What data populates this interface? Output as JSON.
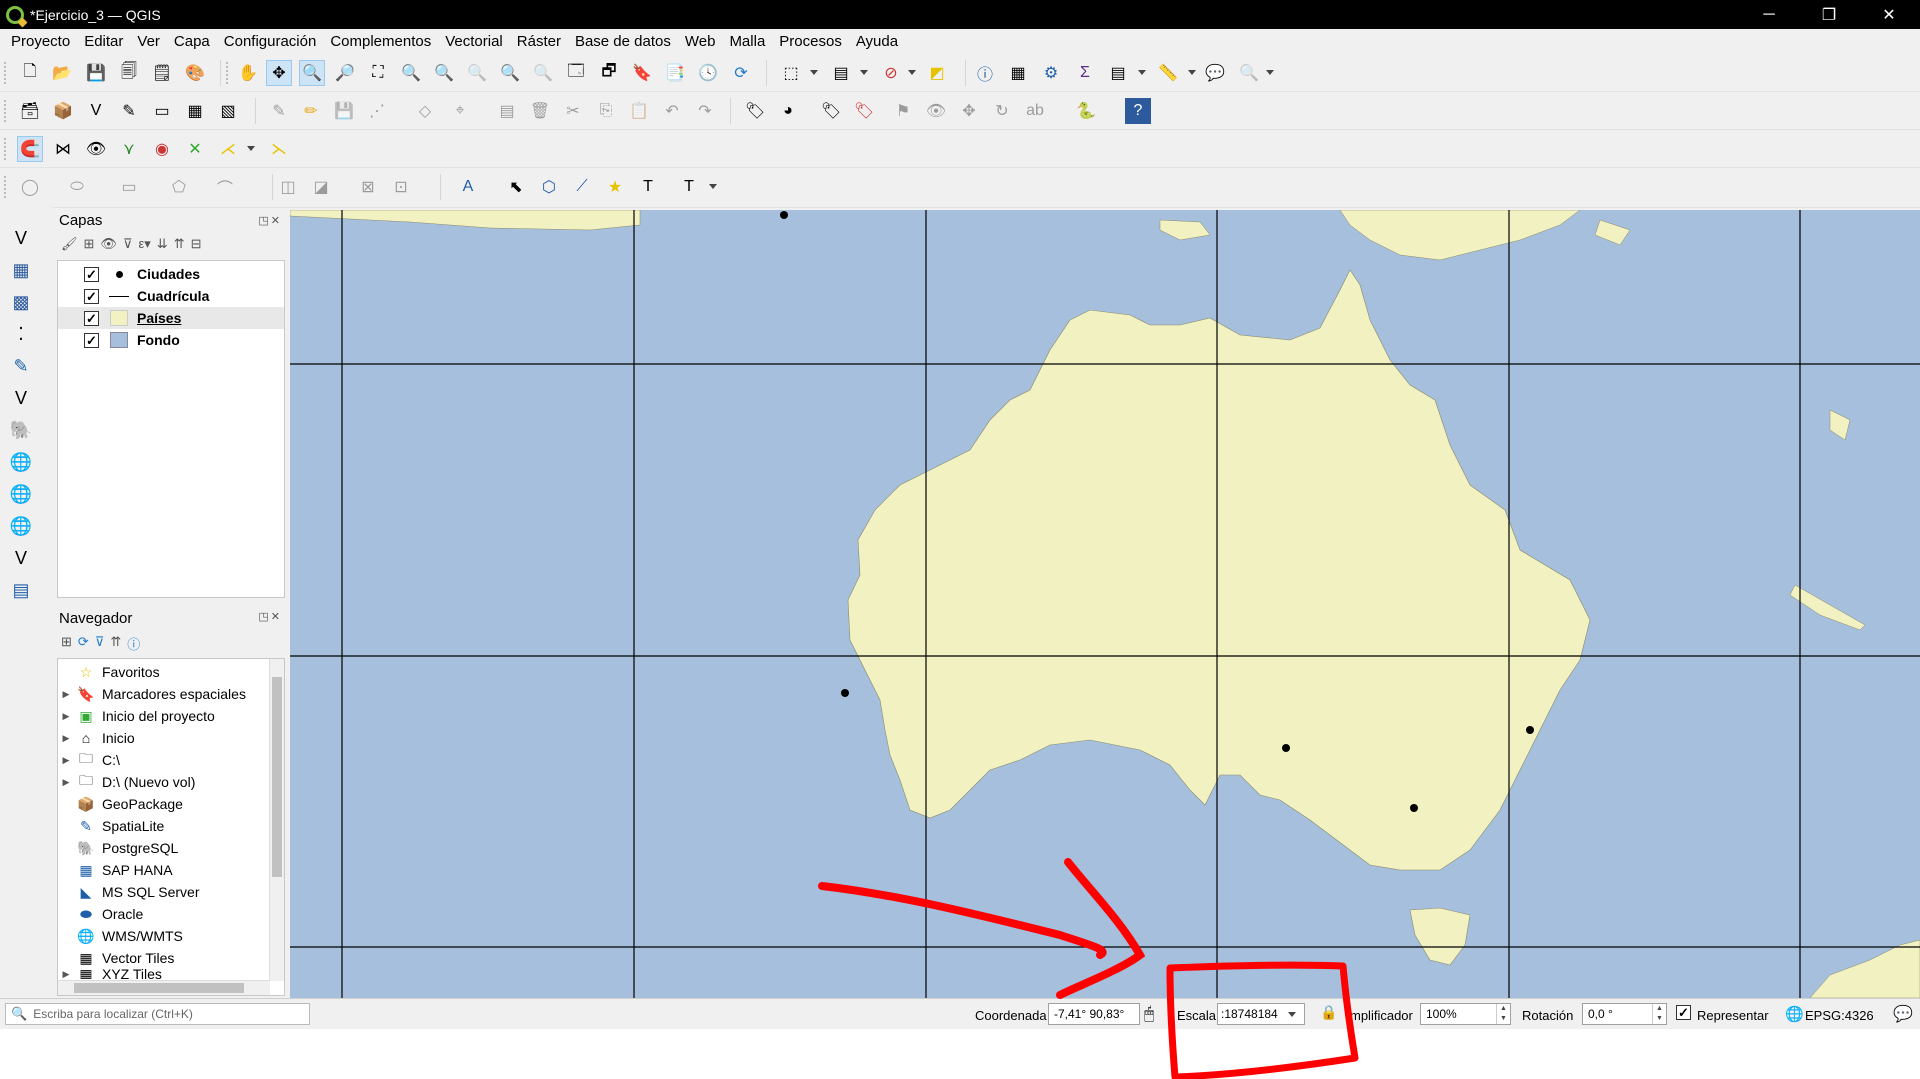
{
  "window": {
    "title": "*Ejercicio_3 — QGIS",
    "minimize": "─",
    "restore": "❐",
    "close": "✕"
  },
  "menu": [
    "Proyecto",
    "Editar",
    "Ver",
    "Capa",
    "Configuración",
    "Complementos",
    "Vectorial",
    "Ráster",
    "Base de datos",
    "Web",
    "Malla",
    "Procesos",
    "Ayuda"
  ],
  "layers_panel": {
    "title": "Capas",
    "layers": [
      {
        "name": "Ciudades",
        "checked": true,
        "symbol": "point"
      },
      {
        "name": "Cuadrícula",
        "checked": true,
        "symbol": "line"
      },
      {
        "name": "Países",
        "checked": true,
        "symbol": "fill",
        "color": "#f2f1c2",
        "selected": true
      },
      {
        "name": "Fondo",
        "checked": true,
        "symbol": "fill",
        "color": "#a5bfdd"
      }
    ]
  },
  "browser_panel": {
    "title": "Navegador",
    "items": [
      {
        "label": "Favoritos",
        "icon": "star-icon",
        "expandable": false
      },
      {
        "label": "Marcadores espaciales",
        "icon": "bookmark-icon",
        "expandable": true
      },
      {
        "label": "Inicio del proyecto",
        "icon": "project-folder-icon",
        "expandable": true
      },
      {
        "label": "Inicio",
        "icon": "home-folder-icon",
        "expandable": true
      },
      {
        "label": "C:\\",
        "icon": "folder-icon",
        "expandable": true
      },
      {
        "label": "D:\\ (Nuevo vol)",
        "icon": "folder-icon",
        "expandable": true
      },
      {
        "label": "GeoPackage",
        "icon": "geopackage-icon",
        "expandable": false
      },
      {
        "label": "SpatiaLite",
        "icon": "spatialite-icon",
        "expandable": false
      },
      {
        "label": "PostgreSQL",
        "icon": "postgresql-icon",
        "expandable": false
      },
      {
        "label": "SAP HANA",
        "icon": "hana-icon",
        "expandable": false
      },
      {
        "label": "MS SQL Server",
        "icon": "mssql-icon",
        "expandable": false
      },
      {
        "label": "Oracle",
        "icon": "oracle-icon",
        "expandable": false
      },
      {
        "label": "WMS/WMTS",
        "icon": "wms-icon",
        "expandable": false
      },
      {
        "label": "Vector Tiles",
        "icon": "vector-tiles-icon",
        "expandable": false
      },
      {
        "label": "XYZ Tiles",
        "icon": "xyz-tiles-icon",
        "expandable": true
      }
    ]
  },
  "map": {
    "ocean_color": "#a5bfdd",
    "land_color": "#f2f1c2",
    "grid_color": "#000000"
  },
  "statusbar": {
    "locator_placeholder": "Escriba para localizar (Ctrl+K)",
    "coordinate_label": "Coordenada",
    "coordinate_value": "-7,41° 90,83°",
    "scale_label": "Escala",
    "scale_value": ":18748184",
    "magnifier_label": "Amplificador",
    "magnifier_visible": "mplificador",
    "magnifier_value": "100%",
    "rotation_label": "Rotación",
    "rotation_value": "0,0 °",
    "render_label": "Representar",
    "render_checked": true,
    "crs": "EPSG:4326"
  },
  "annotation": {
    "color": "#ff0000",
    "arrow": "red hand-drawn arrow pointing to scale box",
    "box": "red hand-drawn rectangle around scale field"
  }
}
